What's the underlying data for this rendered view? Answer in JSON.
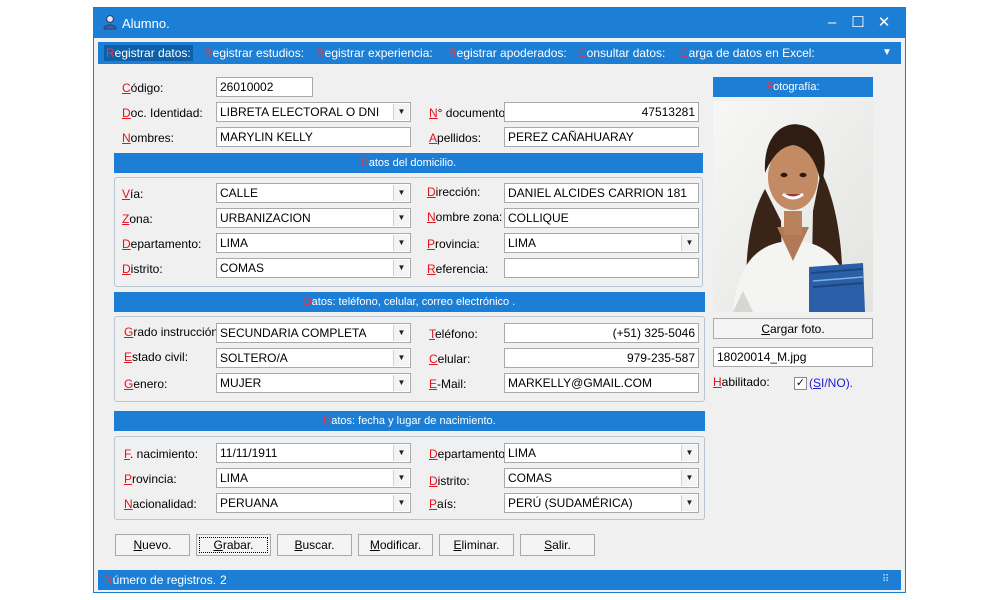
{
  "window": {
    "title": "Alumno.",
    "controls": {
      "minimize": "–",
      "maximize": "☐",
      "close": "✕"
    }
  },
  "menu": [
    {
      "hk": "R",
      "rest": "egistrar datos:"
    },
    {
      "hk": "R",
      "rest": "egistrar estudios:"
    },
    {
      "hk": "R",
      "rest": "egistrar experiencia:"
    },
    {
      "hk": "R",
      "rest": "egistrar apoderados:"
    },
    {
      "hk": "C",
      "rest": "onsultar datos:"
    },
    {
      "hk": "C",
      "rest": "arga de datos en Excel:"
    }
  ],
  "menu_overflow": "▼",
  "header": {
    "codigo": {
      "label_hk": "C",
      "label_rest": "ódigo:",
      "value": "26010002"
    },
    "doc_identidad": {
      "label_hk": "D",
      "label_rest": "oc. Identidad:",
      "value": "LIBRETA ELECTORAL O DNI"
    },
    "n_documento": {
      "label_hk": "N",
      "label_rest": "° documento:",
      "value": "47513281"
    },
    "nombres": {
      "label_hk": "N",
      "label_rest": "ombres:",
      "value": "MARYLIN KELLY"
    },
    "apellidos": {
      "label_hk": "A",
      "label_rest": "pellidos:",
      "value": "PEREZ CAÑAHUARAY"
    }
  },
  "domicilio": {
    "band_hk": "D",
    "band_rest": "atos del domicilio.",
    "via": {
      "label_hk": "V",
      "label_rest": "ía:",
      "value": "CALLE"
    },
    "direccion": {
      "label_hk": "D",
      "label_rest": "irección:",
      "value": "DANIEL ALCIDES CARRION 181"
    },
    "zona": {
      "label_hk": "Z",
      "label_rest": "ona:",
      "value": "URBANIZACION"
    },
    "nombre_zona": {
      "label_hk": "N",
      "label_rest": "ombre zona:",
      "value": "COLLIQUE"
    },
    "departamento": {
      "label_hk": "D",
      "label_rest": "epartamento:",
      "value": "LIMA"
    },
    "provincia": {
      "label_hk": "P",
      "label_rest": "rovincia:",
      "value": "LIMA"
    },
    "distrito": {
      "label_hk": "D",
      "label_rest": "istrito:",
      "value": "COMAS"
    },
    "referencia": {
      "label_hk": "R",
      "label_rest": "eferencia:",
      "value": ""
    }
  },
  "contacto": {
    "band_hk": "D",
    "band_rest": "atos: teléfono, celular, correo electrónico .",
    "grado": {
      "label_hk": "G",
      "label_rest": "rado instrucción:",
      "value": "SECUNDARIA COMPLETA"
    },
    "telefono": {
      "label_hk": "T",
      "label_rest": "eléfono:",
      "value": "(+51) 325-5046"
    },
    "estado_civil": {
      "label_hk": "E",
      "label_rest": "stado civil:",
      "value": "SOLTERO/A"
    },
    "celular": {
      "label_hk": "C",
      "label_rest": "elular:",
      "value": "979-235-587"
    },
    "genero": {
      "label_hk": "G",
      "label_rest": "enero:",
      "value": "MUJER"
    },
    "email": {
      "label_hk": "E",
      "label_rest": "-Mail:",
      "value": "MARKELLY@GMAIL.COM"
    }
  },
  "nacimiento": {
    "band_hk": "D",
    "band_rest": "atos: fecha y lugar de nacimiento.",
    "fecha": {
      "label_hk": "F",
      "label_rest": ". nacimiento:",
      "value": "11/11/1911"
    },
    "departamento": {
      "label_hk": "D",
      "label_rest": "epartamento:",
      "value": "LIMA"
    },
    "provincia": {
      "label_hk": "P",
      "label_rest": "rovincia:",
      "value": "LIMA"
    },
    "distrito": {
      "label_hk": "D",
      "label_rest": "istrito:",
      "value": "COMAS"
    },
    "nacionalidad": {
      "label_hk": "N",
      "label_rest": "acionalidad:",
      "value": "PERUANA"
    },
    "pais": {
      "label_hk": "P",
      "label_rest": "aís:",
      "value": "PERÚ (SUDAMÉRICA)"
    }
  },
  "foto": {
    "band_hk": "F",
    "band_rest": "otografía:",
    "cargar_hk": "C",
    "cargar_rest": "argar foto.",
    "filename": "18020014_M.jpg",
    "habilitado_hk": "H",
    "habilitado_rest": "abilitado:",
    "checked": "✓",
    "sino_open": "(",
    "sino_hk": "S",
    "sino_rest": "I/NO",
    "sino_close": ")."
  },
  "buttons": [
    {
      "hk": "N",
      "rest": "uevo."
    },
    {
      "hk": "G",
      "rest": "rabar."
    },
    {
      "hk": "B",
      "rest": "uscar."
    },
    {
      "hk": "M",
      "rest": "odificar."
    },
    {
      "hk": "E",
      "rest": "liminar."
    },
    {
      "hk": "S",
      "rest": "alir."
    }
  ],
  "status": {
    "label_hk": "N",
    "label_rest": "úmero de registros.",
    "count": "2"
  },
  "icons": {
    "dropdown": "▼",
    "grip": "⠿"
  },
  "colors": {
    "accent": "#1c7fd5",
    "hotkey": "#e8101a"
  }
}
